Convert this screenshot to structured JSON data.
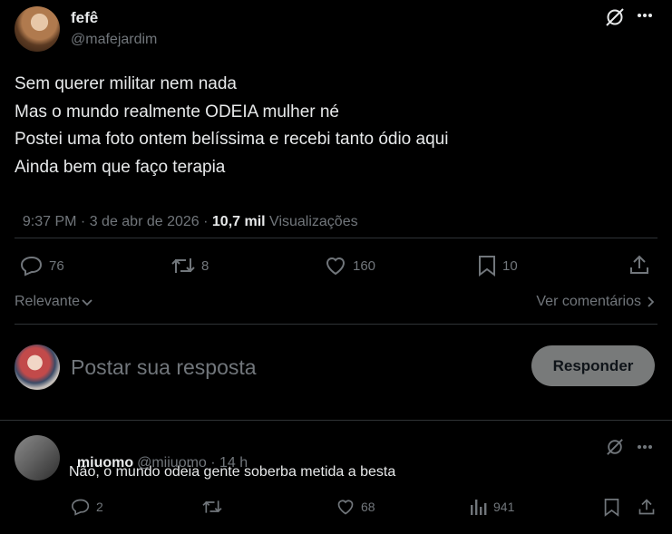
{
  "tweet": {
    "display_name": "fefê",
    "handle": "@mafejardim",
    "lines": [
      "Sem querer militar nem nada",
      "Mas o mundo realmente ODEIA mulher né",
      "Postei uma foto ontem belíssima e recebi tanto ódio aqui",
      "Ainda bem que faço terapia"
    ],
    "time": "9:37 PM · 3 de abr de 2026 · ",
    "views_count": "10,7 mil",
    "views_label": " Visualizações",
    "replies": "76",
    "reposts": "8",
    "likes": "160",
    "bookmarks": "10"
  },
  "sort": {
    "label": "Relevante",
    "view_comments": "Ver comentários"
  },
  "composer": {
    "placeholder": "Postar sua resposta",
    "button": "Responder"
  },
  "reply": {
    "display_name": "miuomo",
    "handle": "@miiuomo",
    "time": " · 14 h",
    "text": "Não, o mundo odeia gente soberba metida a besta",
    "replies": "2",
    "likes": "68",
    "views": "941"
  },
  "colors": {
    "background": "#000000",
    "text": "#e7e9ea",
    "muted": "#71767b",
    "divider": "#2f3336",
    "button_bg": "#787a7a"
  }
}
